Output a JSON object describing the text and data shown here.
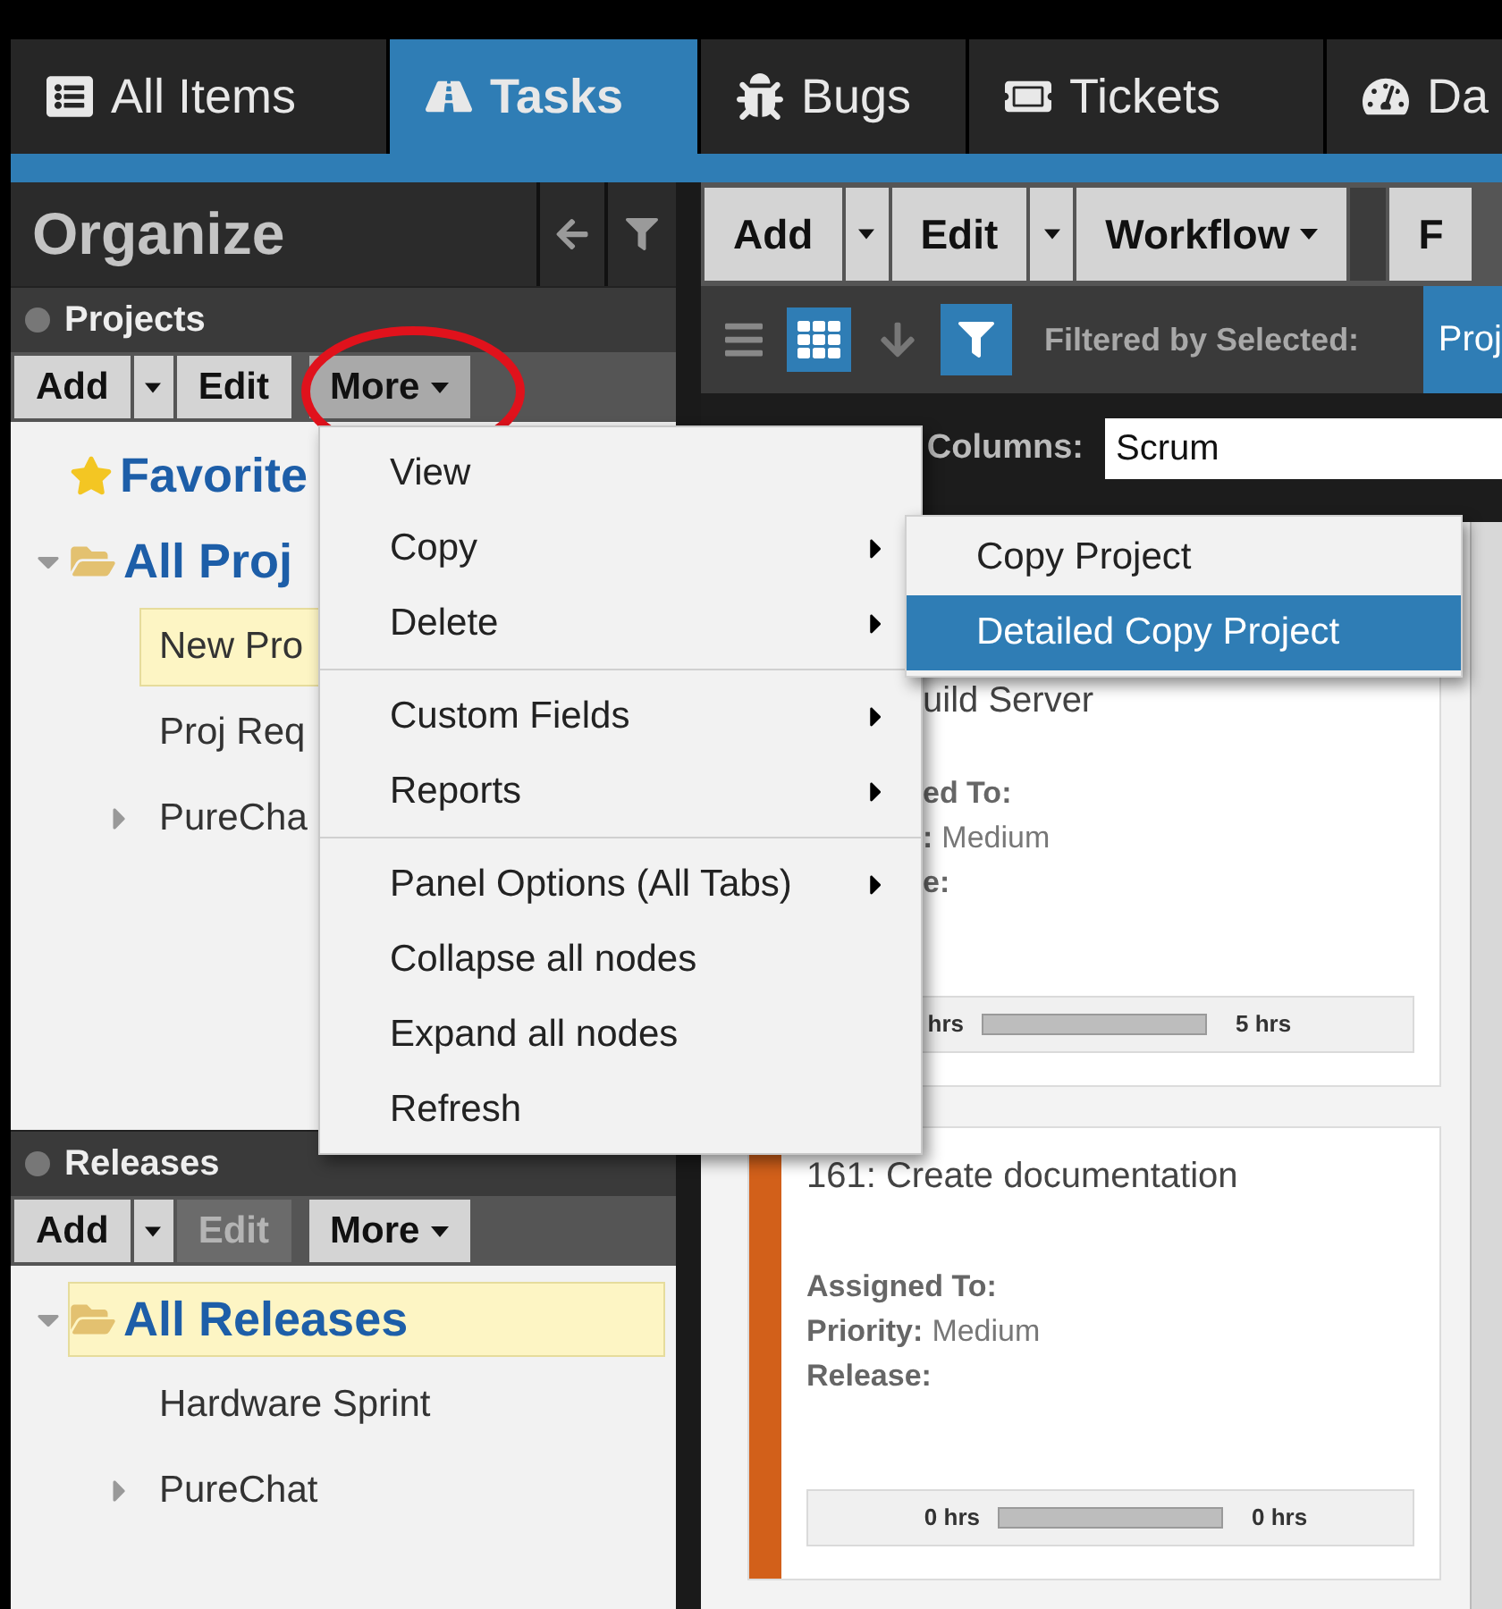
{
  "tabs": [
    {
      "label": "All Items",
      "selected": false
    },
    {
      "label": "Tasks",
      "selected": true
    },
    {
      "label": "Bugs",
      "selected": false
    },
    {
      "label": "Tickets",
      "selected": false
    },
    {
      "label": "Da",
      "selected": false
    }
  ],
  "organize": {
    "title": "Organize"
  },
  "panels": [
    {
      "title": "Projects",
      "toolbar": [
        {
          "kind": "button",
          "label": "Add",
          "disabled": false
        },
        {
          "kind": "caret"
        },
        {
          "kind": "button",
          "label": "Edit",
          "disabled": false
        },
        {
          "kind": "menu",
          "label": "More",
          "open": true
        }
      ],
      "tree": [
        {
          "kind": "favorites",
          "label": "Favorite",
          "selected": false
        },
        {
          "kind": "folder",
          "label": "All Proj",
          "expanded": true,
          "selected": false,
          "children": [
            {
              "label": "New Pro",
              "selected": true
            },
            {
              "label": "Proj Req",
              "selected": false
            },
            {
              "label": "PureCha",
              "selected": false,
              "expanded": false
            }
          ]
        }
      ]
    },
    {
      "title": "Releases",
      "toolbar": [
        {
          "kind": "button",
          "label": "Add",
          "disabled": false
        },
        {
          "kind": "caret"
        },
        {
          "kind": "button",
          "label": "Edit",
          "disabled": true
        },
        {
          "kind": "menu",
          "label": "More",
          "open": false
        }
      ],
      "tree": [
        {
          "kind": "folder",
          "label": "All Releases",
          "expanded": true,
          "selected": true,
          "children": [
            {
              "label": "Hardware Sprint",
              "selected": false
            },
            {
              "label": "PureChat",
              "selected": false,
              "expanded": false
            }
          ]
        }
      ]
    }
  ],
  "toolbar": [
    {
      "kind": "button",
      "label": "Add"
    },
    {
      "kind": "caret"
    },
    {
      "kind": "button",
      "label": "Edit"
    },
    {
      "kind": "caret"
    },
    {
      "kind": "menu",
      "label": "Workflow"
    },
    {
      "kind": "separator"
    },
    {
      "kind": "button",
      "label": "F"
    }
  ],
  "view_toggle": [
    {
      "kind": "list",
      "selected": false
    },
    {
      "kind": "grid",
      "selected": true
    }
  ],
  "filter": {
    "active": true,
    "label": "Filtered by Selected:",
    "value": "Proj"
  },
  "columns": {
    "label": "Columns:",
    "value": "Scrum"
  },
  "cards": [
    {
      "title": "uild Server",
      "fields": [
        {
          "label": "ed To:"
        },
        {
          "label": ":",
          "value": "Medium"
        },
        {
          "label": "e:"
        }
      ],
      "hours_left": "hrs",
      "hours_right": "5 hrs"
    },
    {
      "title": "161: Create documentation",
      "color": "#d2601a",
      "fields": [
        {
          "label": "Assigned To:"
        },
        {
          "label": "Priority:",
          "value": "Medium"
        },
        {
          "label": "Release:"
        }
      ],
      "hours_left": "0 hrs",
      "hours_right": "0 hrs"
    }
  ],
  "context_menu": {
    "items": [
      {
        "kind": "item",
        "label": "View",
        "submenu": false
      },
      {
        "kind": "item",
        "label": "Copy",
        "submenu": true
      },
      {
        "kind": "item",
        "label": "Delete",
        "submenu": true
      },
      {
        "kind": "separator"
      },
      {
        "kind": "item",
        "label": "Custom Fields",
        "submenu": true
      },
      {
        "kind": "item",
        "label": "Reports",
        "submenu": true
      },
      {
        "kind": "separator"
      },
      {
        "kind": "item",
        "label": "Panel Options (All Tabs)",
        "submenu": true
      },
      {
        "kind": "item",
        "label": "Collapse all nodes",
        "submenu": false
      },
      {
        "kind": "item",
        "label": "Expand all nodes",
        "submenu": false
      },
      {
        "kind": "item",
        "label": "Refresh",
        "submenu": false
      }
    ]
  },
  "submenu": {
    "items": [
      {
        "label": "Copy Project",
        "selected": false
      },
      {
        "label": "Detailed Copy Project",
        "selected": true
      }
    ]
  }
}
